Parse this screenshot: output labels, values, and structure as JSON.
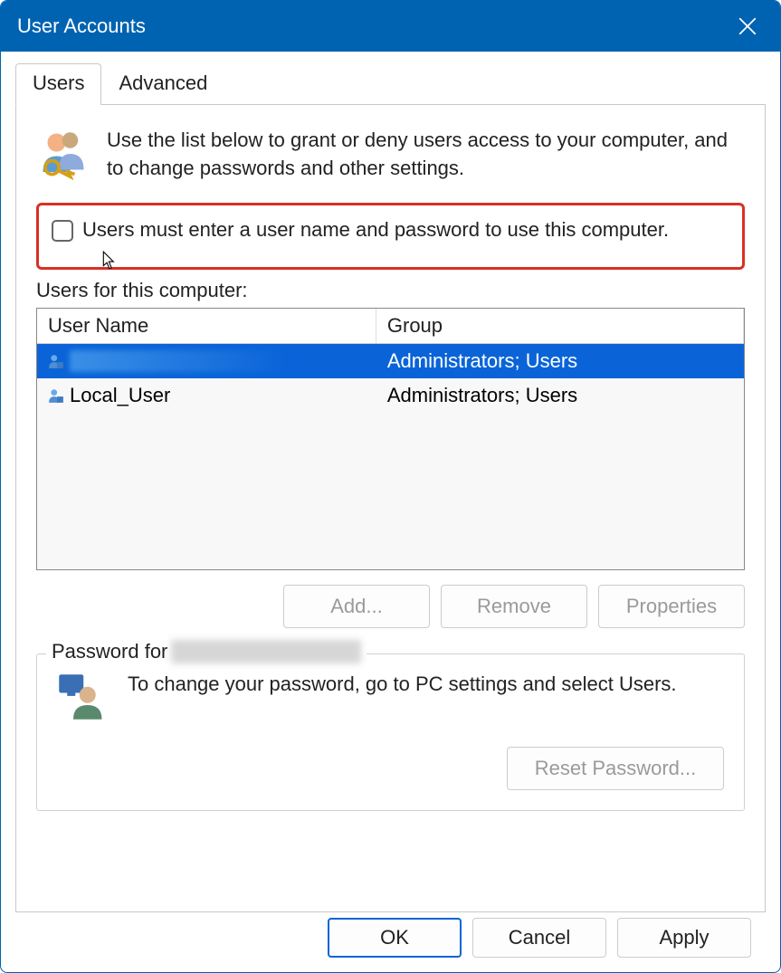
{
  "window": {
    "title": "User Accounts"
  },
  "tabs": [
    {
      "label": "Users",
      "active": true
    },
    {
      "label": "Advanced",
      "active": false
    }
  ],
  "intro_text": "Use the list below to grant or deny users access to your computer, and to change passwords and other settings.",
  "checkbox": {
    "label": "Users must enter a user name and password to use this computer.",
    "checked": false
  },
  "users_section_label": "Users for this computer:",
  "list": {
    "columns": {
      "name": "User Name",
      "group": "Group"
    },
    "rows": [
      {
        "name": "",
        "group": "Administrators; Users",
        "selected": true
      },
      {
        "name": "Local_User",
        "group": "Administrators; Users",
        "selected": false
      }
    ]
  },
  "buttons": {
    "add": "Add...",
    "remove": "Remove",
    "properties": "Properties"
  },
  "password_group": {
    "title_prefix": "Password for",
    "text": "To change your password, go to PC settings and select Users.",
    "reset_button": "Reset Password..."
  },
  "dialog_buttons": {
    "ok": "OK",
    "cancel": "Cancel",
    "apply": "Apply"
  }
}
